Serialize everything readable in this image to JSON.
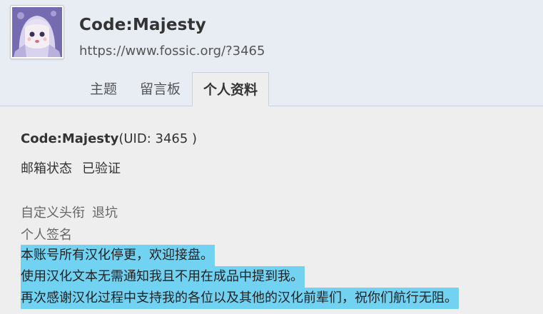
{
  "header": {
    "username": "Code:Majesty",
    "profile_url": "https://www.fossic.org/?3465"
  },
  "tabs": [
    {
      "label": "主题",
      "active": false
    },
    {
      "label": "留言板",
      "active": false
    },
    {
      "label": "个人资料",
      "active": true
    }
  ],
  "profile": {
    "name": "Code:Majesty",
    "uid_text": "(UID: 3465 )",
    "email_status_label": "邮箱状态",
    "email_status_value": "已验证",
    "custom_title_label": "自定义头衔",
    "custom_title_value": "退坑",
    "signature_label": "个人签名",
    "signature_lines": [
      "本账号所有汉化停更，欢迎接盘。",
      "使用汉化文本无需通知我且不用在成品中提到我。",
      "再次感谢汉化过程中支持我的各位以及其他的汉化前辈们，祝你们航行无阻。"
    ]
  },
  "colors": {
    "header_bg": "#e8edf3",
    "page_bg": "#eeeeee",
    "selection_highlight": "#72d2f2"
  }
}
